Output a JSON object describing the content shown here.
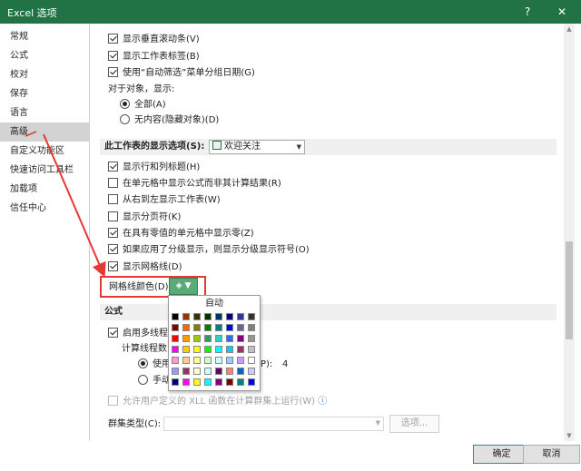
{
  "window": {
    "title": "Excel 选项",
    "help": "?",
    "close": "✕"
  },
  "sidebar": {
    "items": [
      {
        "label": "常规"
      },
      {
        "label": "公式"
      },
      {
        "label": "校对"
      },
      {
        "label": "保存"
      },
      {
        "label": "语言"
      },
      {
        "label": "高级",
        "selected": true
      },
      {
        "label": "自定义功能区"
      },
      {
        "label": "快速访问工具栏"
      },
      {
        "label": "加载项"
      },
      {
        "label": "信任中心"
      }
    ]
  },
  "content": {
    "top_options": [
      {
        "label": "显示垂直滚动条(V)",
        "checked": true
      },
      {
        "label": "显示工作表标签(B)",
        "checked": true
      },
      {
        "label": "使用“自动筛选”菜单分组日期(G)",
        "checked": true
      }
    ],
    "objects_label": "对于对象，显示:",
    "object_radios": [
      {
        "label": "全部(A)",
        "checked": true
      },
      {
        "label": "无内容(隐藏对象)(D)",
        "checked": false
      }
    ],
    "sheet_section": {
      "label": "此工作表的显示选项(S):",
      "selected_sheet": "欢迎关注"
    },
    "sheet_options": [
      {
        "label": "显示行和列标题(H)",
        "checked": true
      },
      {
        "label": "在单元格中显示公式而非其计算结果(R)",
        "checked": false
      },
      {
        "label": "从右到左显示工作表(W)",
        "checked": false
      },
      {
        "label": "显示分页符(K)",
        "checked": false
      },
      {
        "label": "在具有零值的单元格中显示零(Z)",
        "checked": true
      },
      {
        "label": "如果应用了分级显示，则显示分级显示符号(O)",
        "checked": true
      },
      {
        "label": "显示网格线(D)",
        "checked": true
      }
    ],
    "gridline_color_label": "网格线颜色(D)",
    "formula_section": {
      "label": "公式"
    },
    "multithread_label": "启用多线程计",
    "thread_count_label": "计算线程数",
    "thread_use_label": "使用",
    "thread_use_suffix": "P):",
    "thread_count_value": "4",
    "thread_manual_label": "手动",
    "xll_label": "允许用户定义的 XLL 函数在计算群集上运行(W)",
    "cluster_type_label": "群集类型(C):",
    "options_button": "选项..."
  },
  "palette": {
    "auto_label": "自动",
    "colors": [
      [
        "#000000",
        "#993300",
        "#333300",
        "#003300",
        "#003366",
        "#000080",
        "#333399",
        "#333333"
      ],
      [
        "#800000",
        "#FF6600",
        "#808000",
        "#008000",
        "#008080",
        "#0000FF",
        "#666699",
        "#808080"
      ],
      [
        "#FF0000",
        "#FF9900",
        "#99CC00",
        "#339966",
        "#33CCCC",
        "#3366FF",
        "#800080",
        "#969696"
      ],
      [
        "#FF00FF",
        "#FFCC00",
        "#FFFF00",
        "#00FF00",
        "#00FFFF",
        "#00CCFF",
        "#993366",
        "#C0C0C0"
      ],
      [
        "#FF99CC",
        "#FFCC99",
        "#FFFF99",
        "#CCFFCC",
        "#CCFFFF",
        "#99CCFF",
        "#CC99FF",
        "#FFFFFF"
      ],
      [
        "#9999FF",
        "#993366",
        "#FFFFCC",
        "#CCFFFF",
        "#660066",
        "#FF8080",
        "#0066CC",
        "#CCCCFF"
      ],
      [
        "#000080",
        "#FF00FF",
        "#FFFF00",
        "#00FFFF",
        "#800080",
        "#800000",
        "#008080",
        "#0000FF"
      ]
    ]
  },
  "footer": {
    "ok": "确定",
    "cancel": "取消"
  },
  "annotation": {
    "color": "#E53935"
  }
}
